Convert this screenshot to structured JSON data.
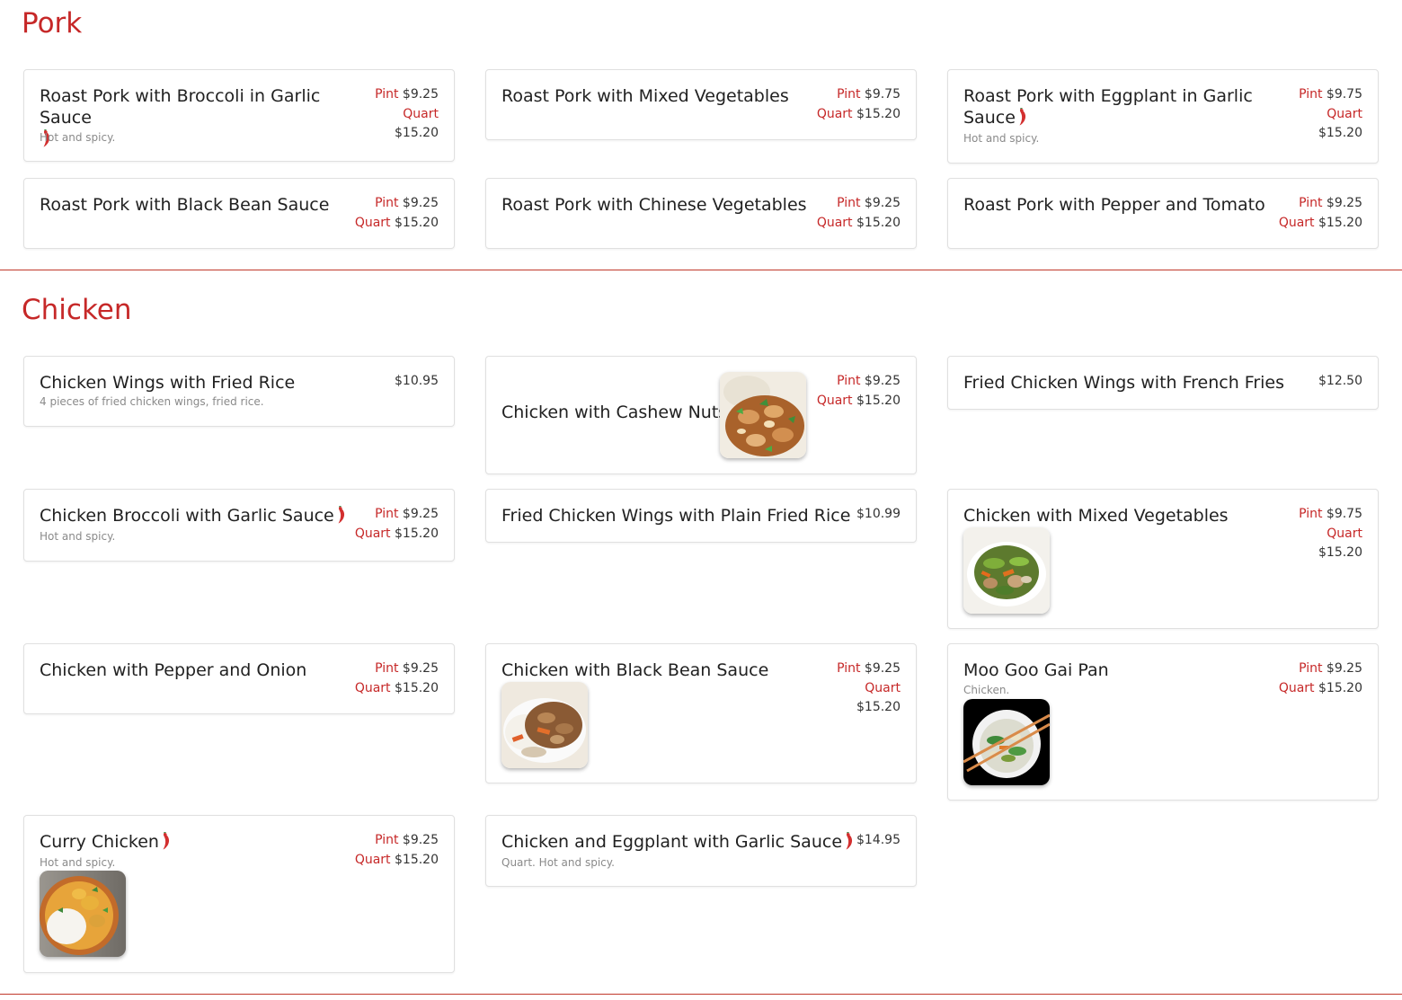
{
  "sections": {
    "pork": {
      "title": "Pork",
      "items": [
        {
          "name": "Roast Pork with Broccoli in Garlic Sauce",
          "desc": "Hot and spicy.",
          "pint_label": "Pint",
          "pint_price": "$9.25",
          "quart_label": "Quart",
          "quart_price": "$15.20"
        },
        {
          "name": "Roast Pork with Mixed Vegetables",
          "pint_label": "Pint",
          "pint_price": "$9.75",
          "quart_label": "Quart",
          "quart_price": "$15.20"
        },
        {
          "name": "Roast Pork with Eggplant in Garlic Sauce",
          "desc": "Hot and spicy.",
          "pint_label": "Pint",
          "pint_price": "$9.75",
          "quart_label": "Quart",
          "quart_price": "$15.20"
        },
        {
          "name": "Roast Pork with Black Bean Sauce",
          "pint_label": "Pint",
          "pint_price": "$9.25",
          "quart_label": "Quart",
          "quart_price": "$15.20"
        },
        {
          "name": "Roast Pork with Chinese Vegetables",
          "pint_label": "Pint",
          "pint_price": "$9.25",
          "quart_label": "Quart",
          "quart_price": "$15.20"
        },
        {
          "name": "Roast Pork with Pepper and Tomato",
          "pint_label": "Pint",
          "pint_price": "$9.25",
          "quart_label": "Quart",
          "quart_price": "$15.20"
        }
      ]
    },
    "chicken": {
      "title": "Chicken",
      "items": [
        {
          "name": "Chicken Wings with Fried Rice",
          "desc": "4 pieces of fried chicken wings, fried rice.",
          "price": "$10.95"
        },
        {
          "name": "Chicken with Cashew Nuts",
          "pint_label": "Pint",
          "pint_price": "$9.25",
          "quart_label": "Quart",
          "quart_price": "$15.20"
        },
        {
          "name": "Fried Chicken Wings with French Fries",
          "price": "$12.50"
        },
        {
          "name": "Chicken Broccoli with Garlic Sauce",
          "desc": "Hot and spicy.",
          "pint_label": "Pint",
          "pint_price": "$9.25",
          "quart_label": "Quart",
          "quart_price": "$15.20"
        },
        {
          "name": "Fried Chicken Wings with Plain Fried Rice",
          "price": "$10.99"
        },
        {
          "name": "Chicken with Mixed Vegetables",
          "pint_label": "Pint",
          "pint_price": "$9.75",
          "quart_label": "Quart",
          "quart_price": "$15.20"
        },
        {
          "name": "Chicken with Pepper and Onion",
          "pint_label": "Pint",
          "pint_price": "$9.25",
          "quart_label": "Quart",
          "quart_price": "$15.20"
        },
        {
          "name": "Chicken with Black Bean Sauce",
          "pint_label": "Pint",
          "pint_price": "$9.25",
          "quart_label": "Quart",
          "quart_price": "$15.20"
        },
        {
          "name": "Moo Goo Gai Pan",
          "desc": "Chicken.",
          "pint_label": "Pint",
          "pint_price": "$9.25",
          "quart_label": "Quart",
          "quart_price": "$15.20"
        },
        {
          "name": "Curry Chicken",
          "desc": "Hot and spicy.",
          "pint_label": "Pint",
          "pint_price": "$9.25",
          "quart_label": "Quart",
          "quart_price": "$15.20"
        },
        {
          "name": "Chicken and Eggplant with Garlic Sauce",
          "desc": "Quart. Hot and spicy.",
          "price": "$14.95"
        }
      ]
    }
  },
  "icons": {
    "spicy": "chili-pepper-icon"
  },
  "colors": {
    "accent": "#c62828",
    "divider": "#c0392b",
    "chili": "#d32f2f"
  }
}
